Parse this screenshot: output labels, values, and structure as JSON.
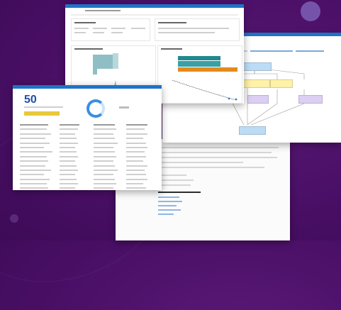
{
  "collage": {
    "accent": "#1e73c8",
    "background": "#4a0f66"
  },
  "dashboard": {
    "title": "",
    "chart_colors": {
      "teal": "#8fbfc4",
      "dark_teal": "#1f8a8f",
      "orange": "#e38a1c",
      "blue": "#2f7fd6"
    }
  },
  "list_panel": {
    "count": "50",
    "progress_color": "#e8c93a",
    "donut_color": "#3a8ee6"
  },
  "workflow": {
    "node_colors": {
      "blue": "#bcdcf5",
      "yellow": "#fff1a8",
      "purple": "#dccff3"
    }
  },
  "document": {}
}
